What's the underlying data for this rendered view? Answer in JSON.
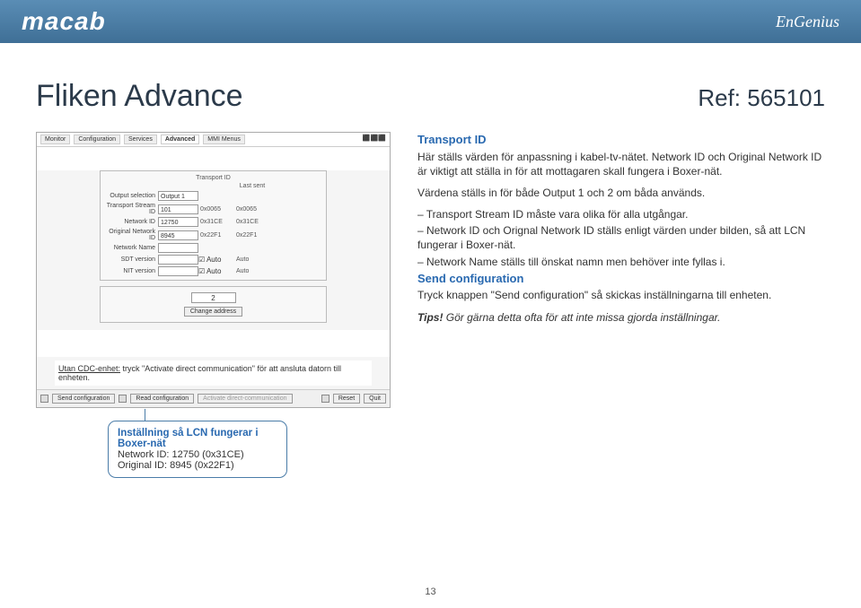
{
  "header": {
    "logo_left": "macab",
    "logo_right": "EnGenius"
  },
  "page": {
    "title": "Fliken Advance",
    "ref": "Ref: 565101",
    "page_number": "13"
  },
  "screenshot": {
    "tabs": [
      "Monitor",
      "Configuration",
      "Services",
      "Advanced",
      "MMI Menus"
    ],
    "active_tab": "Advanced",
    "panel_title": "Transport ID",
    "header_right": "Last sent",
    "rows": [
      {
        "label": "Output selection",
        "value": "Output 1",
        "hex": "",
        "ro": ""
      },
      {
        "label": "Transport Stream ID",
        "value": "101",
        "hex": "0x0065",
        "ro": "0x0065"
      },
      {
        "label": "Network ID",
        "value": "12750",
        "hex": "0x31CE",
        "ro": "0x31CE"
      },
      {
        "label": "Original Network ID",
        "value": "8945",
        "hex": "0x22F1",
        "ro": "0x22F1"
      },
      {
        "label": "Network Name",
        "value": "",
        "hex": "",
        "ro": ""
      },
      {
        "label": "SDT version",
        "value": "",
        "chk": true,
        "chk_label": "Auto",
        "ro": "Auto"
      },
      {
        "label": "NIT version",
        "value": "",
        "chk": true,
        "chk_label": "Auto",
        "ro": "Auto"
      }
    ],
    "addr_value": "2",
    "addr_button": "Change address",
    "warn_prefix": "Utan CDC-enhet:",
    "warn_text": " tryck \"Activate direct communication\" för att ansluta datorn till enheten.",
    "bottom_buttons": [
      "Send configuration",
      "Read configuration",
      "Activate direct-communication",
      "Reset",
      "Quit"
    ]
  },
  "right": {
    "transport_title": "Transport ID",
    "transport_p1": "Här ställs värden för anpassning i kabel-tv-nätet. Network ID och Original Network ID är viktigt att ställa in för att mottagaren skall fungera i Boxer-nät.",
    "transport_p2": "Värdena ställs in för både Output 1 och 2 om båda används.",
    "bullet1": "– Transport Stream ID måste vara olika för alla utgångar.",
    "bullet2": "– Network ID och Orignal Network ID ställs enligt värden under bilden, så att LCN fungerar  i Boxer-nät.",
    "bullet3": "– Network Name ställs till önskat namn men behöver inte fyllas i.",
    "send_title": "Send configuration",
    "send_p": "Tryck knappen \"Send configuration\" så skickas inställningarna till enheten.",
    "tips_label": "Tips!",
    "tips_text": " Gör gärna detta ofta för att inte missa gjorda inställningar."
  },
  "callout": {
    "title": "Inställning så LCN fungerar i Boxer-nät",
    "line1": "Network ID: 12750 (0x31CE)",
    "line2": "Original ID: 8945 (0x22F1)"
  }
}
